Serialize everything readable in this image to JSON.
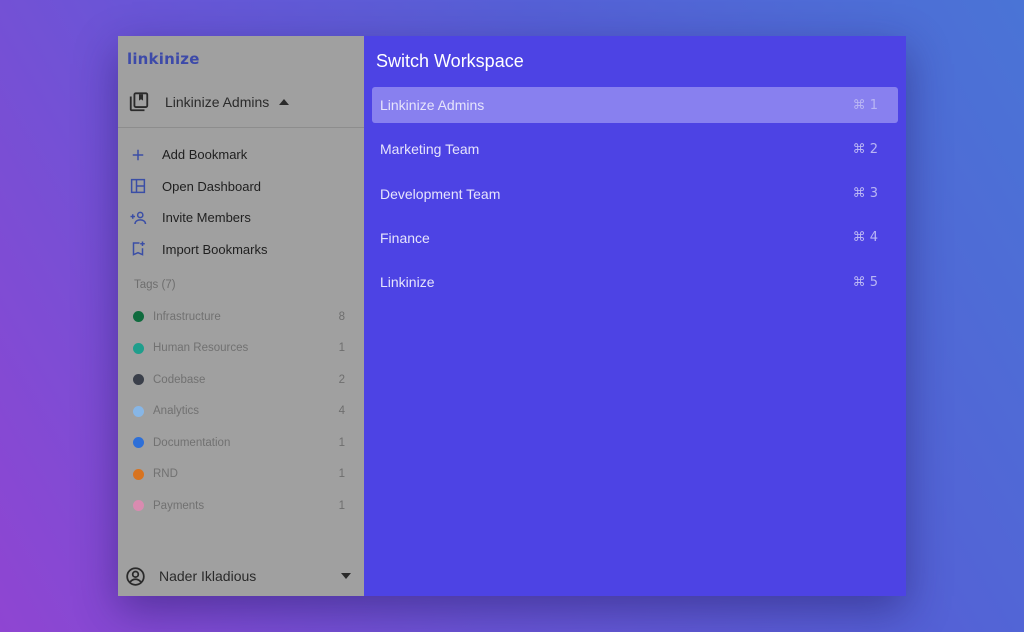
{
  "app": {
    "logo_text": "linkinize"
  },
  "workspace_switcher": {
    "current": "Linkinize Admins"
  },
  "actions": [
    {
      "label": "Add Bookmark",
      "icon": "plus-icon"
    },
    {
      "label": "Open Dashboard",
      "icon": "dashboard-icon"
    },
    {
      "label": "Invite Members",
      "icon": "person-add-icon"
    },
    {
      "label": "Import Bookmarks",
      "icon": "bookmark-import-icon"
    }
  ],
  "tags": {
    "header": "Tags (7)",
    "items": [
      {
        "name": "Infrastructure",
        "count": "8",
        "color": "#0f6b3e"
      },
      {
        "name": "Human Resources",
        "count": "1",
        "color": "#1f9e8c"
      },
      {
        "name": "Codebase",
        "count": "2",
        "color": "#3a3f4a"
      },
      {
        "name": "Analytics",
        "count": "4",
        "color": "#87b6e6"
      },
      {
        "name": "Documentation",
        "count": "1",
        "color": "#2d6fd8"
      },
      {
        "name": "RND",
        "count": "1",
        "color": "#d8731f"
      },
      {
        "name": "Payments",
        "count": "1",
        "color": "#d98bb0"
      }
    ]
  },
  "user": {
    "name": "Nader Ikladious"
  },
  "modal": {
    "title": "Switch Workspace",
    "workspaces": [
      {
        "label": "Linkinize Admins",
        "shortcut": "⌘ 1",
        "active": true
      },
      {
        "label": "Marketing Team",
        "shortcut": "⌘ 2",
        "active": false
      },
      {
        "label": "Development Team",
        "shortcut": "⌘ 3",
        "active": false
      },
      {
        "label": "Finance",
        "shortcut": "⌘ 4",
        "active": false
      },
      {
        "label": "Linkinize",
        "shortcut": "⌘ 5",
        "active": false
      }
    ]
  },
  "colors": {
    "panel_bg": "#4d43e4",
    "active_item_bg": "#8880ef",
    "sidebar_bg": "#a0a0a0",
    "logo": "#3d4aa9"
  }
}
